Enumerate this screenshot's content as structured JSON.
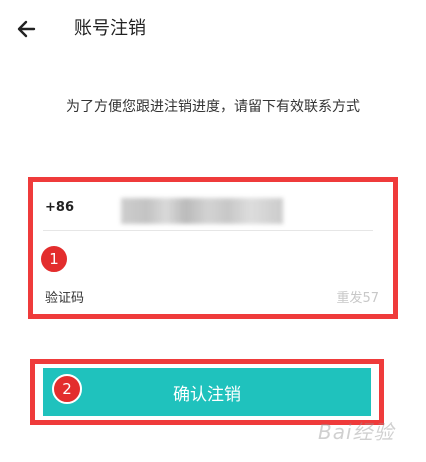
{
  "header": {
    "back_icon": "arrow-left-icon",
    "title": "账号注销"
  },
  "hint": "为了方便您跟进注销进度，请留下有效联系方式",
  "form": {
    "country_code": "+86",
    "code_label": "验证码",
    "resend_label": "重发57"
  },
  "annotations": {
    "badge_1": "1",
    "badge_2": "2"
  },
  "confirm_label": "确认注销",
  "watermark": "Bai经验",
  "colors": {
    "accent": "#1fc2bd",
    "annotation_red": "#ef3b3b",
    "resend_text": "#c8c8c8"
  }
}
